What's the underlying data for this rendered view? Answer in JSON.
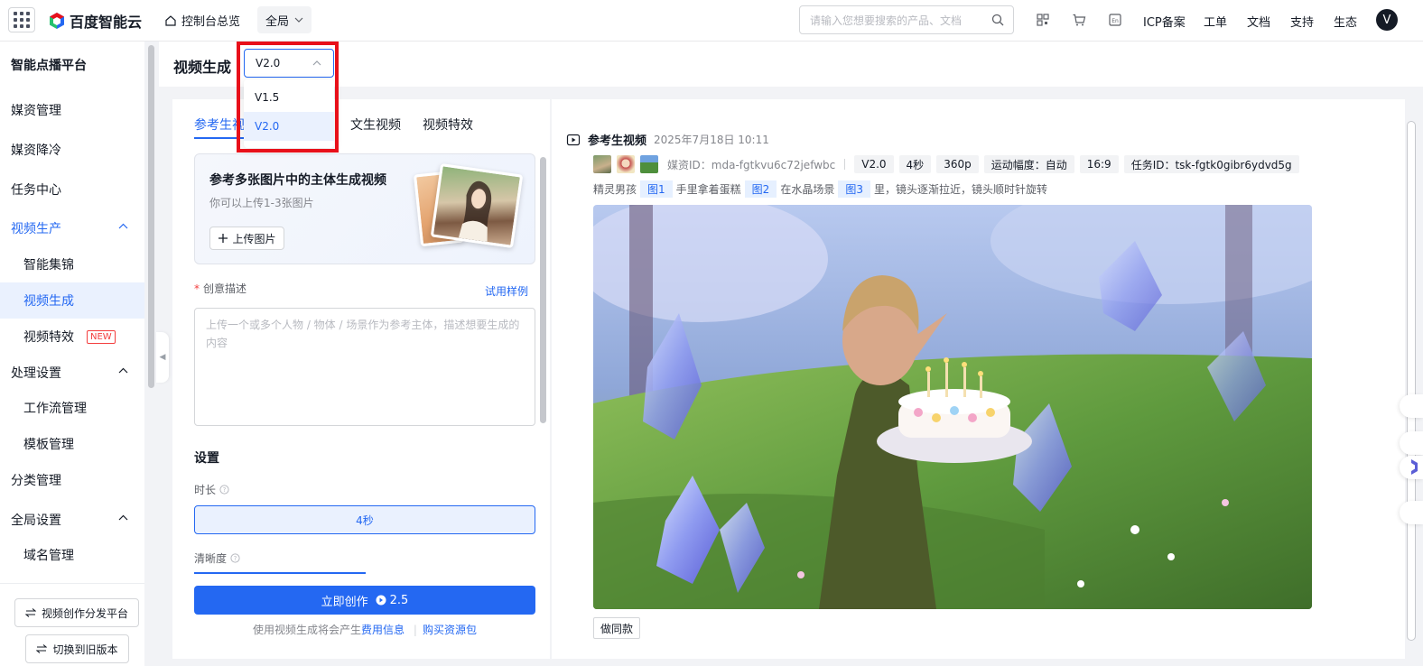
{
  "topbar": {
    "brand": "百度智能云",
    "console_label": "控制台总览",
    "region_label": "全局",
    "search_placeholder": "请输入您想要搜索的产品、文档",
    "links": [
      "ICP备案",
      "工单",
      "文档",
      "支持",
      "生态"
    ],
    "avatar_letter": "V",
    "icons": [
      "apps-grid-icon",
      "qrcode-icon",
      "cart-icon",
      "language-icon",
      "search-icon"
    ]
  },
  "sidebar": {
    "title": "智能点播平台",
    "items": [
      {
        "label": "媒资管理"
      },
      {
        "label": "媒资降冷"
      },
      {
        "label": "任务中心"
      },
      {
        "label": "视频生产"
      },
      {
        "label": "智能集锦"
      },
      {
        "label": "视频生成"
      },
      {
        "label": "视频特效",
        "badge": "NEW"
      },
      {
        "label": "处理设置"
      },
      {
        "label": "工作流管理"
      },
      {
        "label": "模板管理"
      },
      {
        "label": "分类管理"
      },
      {
        "label": "全局设置"
      },
      {
        "label": "域名管理"
      }
    ],
    "btn_platform": "视频创作分发平台",
    "btn_old": "切换到旧版本"
  },
  "header": {
    "title": "视频生成",
    "version_value": "V2.0",
    "version_options": [
      "V1.5",
      "V2.0"
    ]
  },
  "left": {
    "tabs": [
      "参考生视频",
      "文生视频",
      "视频特效"
    ],
    "card_title": "参考多张图片中的主体生成视频",
    "card_sub": "你可以上传1-3张图片",
    "upload_label": "上传图片",
    "desc_label": "创意描述",
    "try_example": "试用样例",
    "desc_placeholder": "上传一个或多个人物 / 物体 / 场景作为参考主体，描述想要生成的内容",
    "settings_title": "设置",
    "duration_label": "时长",
    "duration_value": "4秒",
    "clarity_label": "清晰度",
    "create_label": "立即创作",
    "create_cost": "2.5",
    "footer_text": "使用视频生成将会产生",
    "footer_link1": "费用信息",
    "footer_sep": "|",
    "footer_link2": "购买资源包"
  },
  "right": {
    "title": "参考生视频",
    "time": "2025年7月18日 10:11",
    "media_id": "媒资ID：mda-fgtkvu6c72jefwbc",
    "chips": [
      "V2.0",
      "4秒",
      "360p",
      "运动幅度：自动",
      "16:9",
      "任务ID：tsk-fgtk0gibr6ydvd5g"
    ],
    "prompt_parts": [
      "精灵男孩",
      "图1",
      "手里拿着蛋糕",
      "图2",
      "在水晶场景",
      "图3",
      "里，镜头逐渐拉近，镜头顺时针旋转"
    ],
    "same_label": "做同款"
  },
  "colors": {
    "accent": "#2468f2",
    "highlight_box": "#e8101a",
    "badge": "#f33e3e"
  }
}
